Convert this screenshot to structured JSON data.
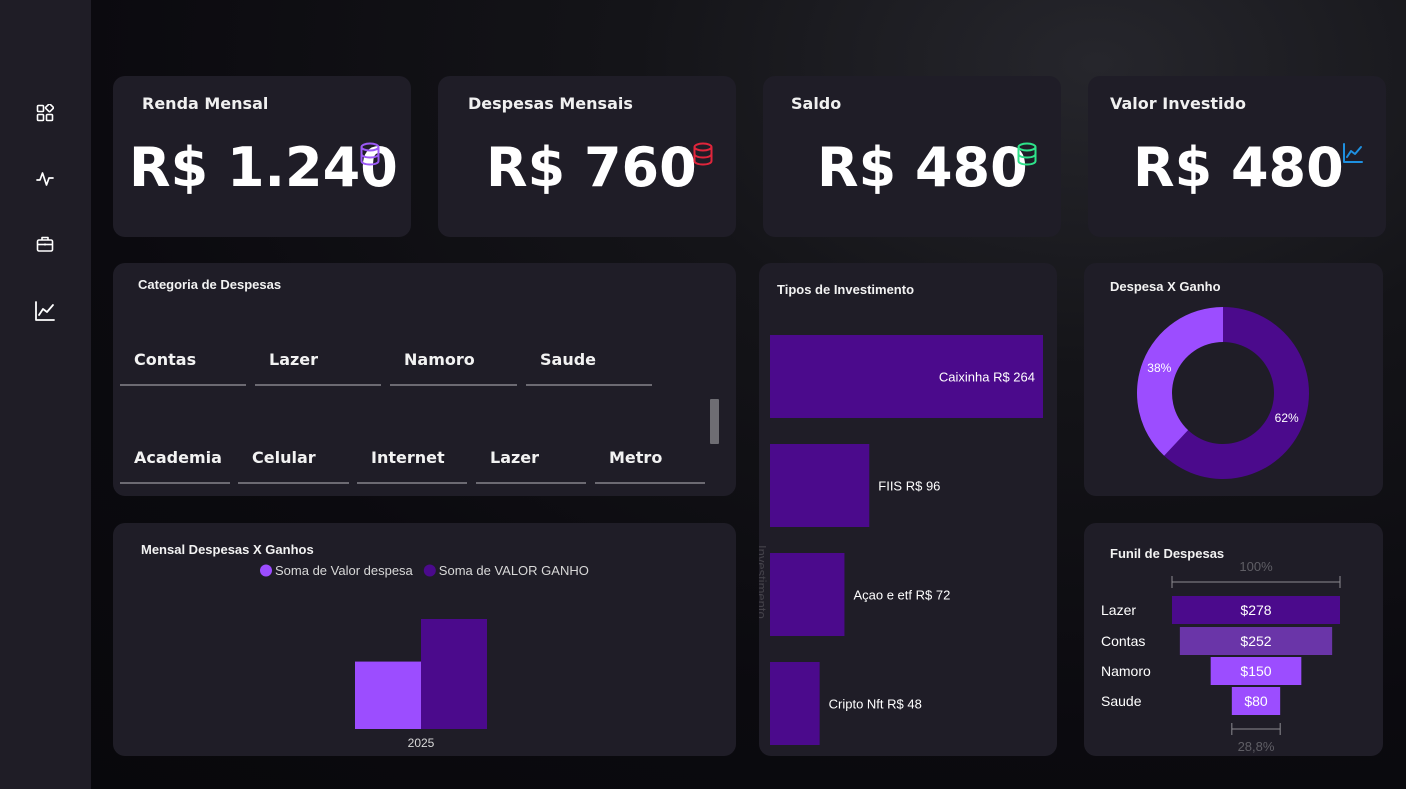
{
  "sidebar": {
    "items": [
      {
        "icon": "dashboard-grid-icon"
      },
      {
        "icon": "activity-pulse-icon"
      },
      {
        "icon": "briefcase-icon"
      },
      {
        "icon": "line-chart-icon"
      }
    ]
  },
  "kpis": {
    "renda": {
      "title": "Renda Mensal",
      "value": "R$ 1.240",
      "icon": "database-icon",
      "color": "#9b59f5"
    },
    "despesas": {
      "title": "Despesas Mensais",
      "value": "R$ 760",
      "icon": "database-icon",
      "color": "#e0253b"
    },
    "saldo": {
      "title": "Saldo",
      "value": "R$ 480",
      "icon": "database-icon",
      "color": "#2ee38a"
    },
    "investido": {
      "title": "Valor Investido",
      "value": "R$ 480",
      "icon": "trend-line-icon",
      "color": "#1e90e0"
    }
  },
  "categoria": {
    "title": "Categoria de Despesas",
    "row1": [
      "Contas",
      "Lazer",
      "Namoro",
      "Saude"
    ],
    "row2": [
      "Academia",
      "Celular",
      "Internet",
      "Lazer",
      "Metro"
    ]
  },
  "mensal": {
    "title": "Mensal Despesas X Ganhos",
    "legend": [
      {
        "label": "Soma de Valor despesa",
        "color": "#9c4dff"
      },
      {
        "label": "Soma de VALOR GANHO",
        "color": "#4b0a8c"
      }
    ],
    "chart_data": {
      "type": "bar",
      "categories": [
        "2025"
      ],
      "series": [
        {
          "name": "Soma de Valor despesa",
          "values": [
            760
          ]
        },
        {
          "name": "Soma de VALOR GANHO",
          "values": [
            1240
          ]
        }
      ]
    }
  },
  "investimento": {
    "title": "Tipos de Investimento",
    "axis_label": "Investimento",
    "chart_data": {
      "type": "bar",
      "orientation": "horizontal",
      "categories": [
        "Caixinha",
        "FIIS",
        "Açao e etf",
        "Cripto Nft"
      ],
      "values": [
        264,
        96,
        72,
        48
      ],
      "labels": [
        "Caixinha R$ 264",
        "FIIS R$ 96",
        "Açao e etf R$ 72",
        "Cripto Nft R$ 48"
      ],
      "color": "#4b0a8c"
    }
  },
  "donut": {
    "title": "Despesa X Ganho",
    "chart_data": {
      "type": "pie",
      "categories": [
        "Despesa",
        "Ganho"
      ],
      "values": [
        38,
        62
      ],
      "labels": [
        "38%",
        "62%"
      ],
      "colors": [
        "#9c4dff",
        "#4b0a8c"
      ]
    }
  },
  "funil": {
    "title": "Funil de Despesas",
    "top_pct": "100%",
    "bottom_pct": "28,8%",
    "chart_data": {
      "type": "bar",
      "categories": [
        "Lazer",
        "Contas",
        "Namoro",
        "Saude"
      ],
      "values": [
        278,
        252,
        150,
        80
      ],
      "labels": [
        "$278",
        "$252",
        "$150",
        "$80"
      ],
      "colors": [
        "#4b0a8c",
        "#6a35a8",
        "#9c4dff",
        "#9c4dff"
      ]
    }
  }
}
